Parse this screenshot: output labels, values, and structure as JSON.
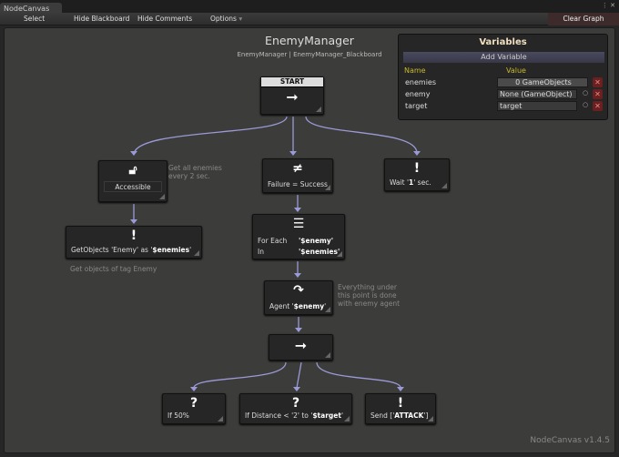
{
  "window": {
    "tab": "NodeCanvas"
  },
  "toolbar": {
    "select": "Select",
    "hide_blackboard": "Hide Blackboard",
    "hide_comments": "Hide Comments",
    "options": "Options",
    "clear_graph": "Clear Graph"
  },
  "graph": {
    "title": "EnemyManager",
    "subtitle": "EnemyManager | EnemyManager_Blackboard",
    "version": "NodeCanvas v1.4.5"
  },
  "variables": {
    "title": "Variables",
    "add": "Add Variable",
    "name_header": "Name",
    "value_header": "Value",
    "rows": [
      {
        "name": "enemies",
        "value": "0 GameObjects"
      },
      {
        "name": "enemy",
        "value": "None (GameObject)"
      },
      {
        "name": "target",
        "value": "target"
      }
    ]
  },
  "nodes": {
    "start": {
      "header": "START",
      "icon": "arrow-right"
    },
    "accessible": {
      "icon": "unlock",
      "label": "Accessible"
    },
    "getobjects": {
      "icon": "exclamation",
      "pre": "GetObjects 'Enemy' as '",
      "var": "$enemies",
      "post": "'"
    },
    "inverter": {
      "icon": "not-equal",
      "label": "Failure = Success"
    },
    "wait": {
      "icon": "exclamation",
      "pre": "Wait '",
      "var": "1",
      "post": "' sec."
    },
    "foreach": {
      "icon": "list",
      "l1": "For Each",
      "v1": "'$enemy'",
      "l2": "In",
      "v2": "'$enemies'"
    },
    "agent": {
      "icon": "redirect-arrow",
      "pre": "Agent '",
      "var": "$enemy",
      "post": "'"
    },
    "sequence": {
      "icon": "arrow-right"
    },
    "if50": {
      "icon": "question",
      "label": "If 50%"
    },
    "ifdist": {
      "icon": "question",
      "pre": "If Distance < '2' to '",
      "var": "$target",
      "post": "'"
    },
    "send": {
      "icon": "exclamation",
      "pre": "Send ['",
      "var": "ATTACK",
      "post": "']"
    }
  },
  "comments": {
    "c1": "Get all enemies every 2 sec.",
    "c2": "Get objects of tag Enemy",
    "c3": "Everything under this point is done with enemy agent"
  }
}
